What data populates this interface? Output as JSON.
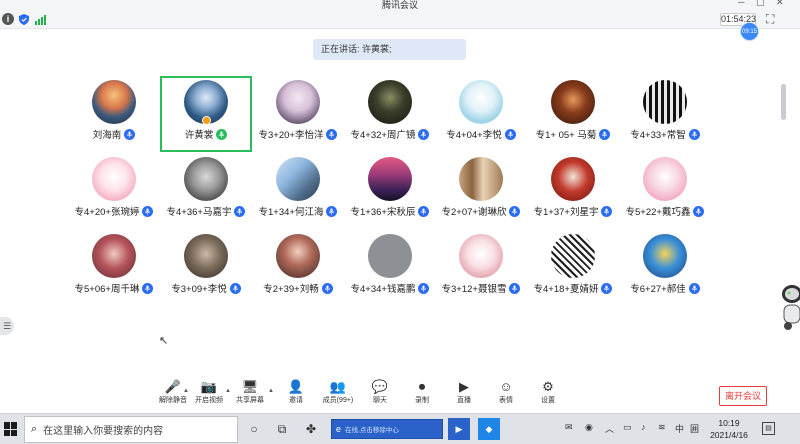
{
  "window": {
    "title": "腾讯会议"
  },
  "topbar": {
    "timer": "01:54:23"
  },
  "speaking": {
    "label": "正在讲话: 许黄裳;"
  },
  "float_badge": "09:15",
  "participants": [
    {
      "name": "刘海南",
      "bg": "radial-gradient(circle at 50% 35%, #f6c27a 0%, #d9774a 35%, #3c5a7d 60%, #1d2b3e 100%)"
    },
    {
      "name": "许黄裳",
      "bg": "radial-gradient(circle at 50% 40%, #dfe9f5 0%, #8fb0d4 30%, #2f5b86 60%, #1b2f45 100%)"
    },
    {
      "name": "专3+20+李怡洋",
      "bg": "radial-gradient(circle at 50% 40%, #f4e8f2 0%, #d7c1d8 40%, #6e5a78 75%, #3c2d44 100%)"
    },
    {
      "name": "专4+32+周广镜",
      "bg": "radial-gradient(circle at 50% 40%, #8a8f66 0%, #3c3f2a 40%, #141511 100%)"
    },
    {
      "name": "专4+04+李悦",
      "bg": "radial-gradient(circle at 50% 40%, #ffffff 0%, #dff1f7 40%, #9ed3e6 70%, #d8eef5 100%)"
    },
    {
      "name": "专1+ 05+ 马菊",
      "bg": "radial-gradient(circle at 50% 45%, #e39a5c 0%, #8a3c1c 40%, #2a150d 100%)"
    },
    {
      "name": "专4+33+常智",
      "bg": "repeating-linear-gradient(90deg, #111 0px, #111 3px, #e9e9e9 3px, #e9e9e9 6px)"
    },
    {
      "name": "专4+20+张琬婷",
      "bg": "radial-gradient(circle at 50% 45%, #ffffff 0%, #fde3ea 40%, #f4a6bb 80%, #f7c7d4 100%)"
    },
    {
      "name": "专4+36+马嘉宇",
      "bg": "radial-gradient(circle at 50% 45%, #d9d9d9 0%, #9a9a9a 40%, #444 80%, #222 100%)"
    },
    {
      "name": "专1+34+何江海",
      "bg": "linear-gradient(135deg, #cfe3f7 0%, #8db5dc 40%, #506e8c 70%, #2a3d52 100%)"
    },
    {
      "name": "专1+36+宋秋辰",
      "bg": "linear-gradient(180deg, #e45a82 0%, #9a3b77 40%, #3a2256 75%, #151026 100%)"
    },
    {
      "name": "专2+07+谢琳欣",
      "bg": "linear-gradient(90deg, #c8a47e 0%, #8a6440 30%, #e8d2b4 55%, #a07b55 100%)"
    },
    {
      "name": "专1+37+刘星宇",
      "bg": "radial-gradient(circle at 50% 45%, #f2e6da 0%, #c23a2c 45%, #6a140e 100%)"
    },
    {
      "name": "专5+22+戴巧鑫",
      "bg": "radial-gradient(circle at 50% 45%, #ffffff 0%, #f7d7e2 40%, #f3a2bf 80%, #f7b8cd 100%)"
    },
    {
      "name": "专5+06+周千琳",
      "bg": "radial-gradient(circle at 50% 45%, #f0c9c0 0%, #b4535a 45%, #5d2a30 100%)"
    },
    {
      "name": "专3+09+李悦",
      "bg": "radial-gradient(circle at 50% 45%, #cbb9a6 0%, #7a6a5a 45%, #2f2a25 100%)"
    },
    {
      "name": "专2+39+刘畅",
      "bg": "radial-gradient(circle at 50% 40%, #f2d0c0 0%, #b06a5a 40%, #3a2522 100%)"
    },
    {
      "name": "专4+34+钱嘉鹏",
      "bg": "#8d9094"
    },
    {
      "name": "专3+12+聂银雪",
      "bg": "radial-gradient(circle at 50% 45%, #ffffff 0%, #f8e0e4 40%, #e6a4ae 75%, #f3c9cf 100%)"
    },
    {
      "name": "专4+18+夏婧妍",
      "bg": "repeating-linear-gradient(45deg, #fafafa 0px, #fafafa 3px, #1e1e1e 3px, #1e1e1e 5px)"
    },
    {
      "name": "专6+27+郝佳",
      "bg": "radial-gradient(circle at 50% 45%, #f5d35a 0%, #3a8fd8 45%, #1c3f78 100%)"
    }
  ],
  "toolbar": {
    "items": [
      {
        "label": "解除静音",
        "icon": "🎤"
      },
      {
        "label": "开启视频",
        "icon": "📷"
      },
      {
        "label": "共享屏幕",
        "icon": "🖥"
      },
      {
        "label": "邀请",
        "icon": "👤"
      },
      {
        "label": "成员(99+)",
        "icon": "👥"
      },
      {
        "label": "聊天",
        "icon": "💬"
      },
      {
        "label": "录制",
        "icon": "⏺"
      },
      {
        "label": "直播",
        "icon": "▶"
      },
      {
        "label": "表情",
        "icon": "☺"
      },
      {
        "label": "设置",
        "icon": "⚙"
      }
    ],
    "leave_label": "离开会议"
  },
  "taskbar": {
    "search_placeholder": "在这里输入你要搜索的内容",
    "search2_placeholder": "在线,点击移除中心",
    "ime_label": "中",
    "ime2_label": "囲",
    "time": "10:19",
    "date": "2021/4/16"
  },
  "colors": {
    "accent": "#2b6cf5",
    "active_border": "#2bbd5c",
    "leave": "#e63b3b"
  }
}
